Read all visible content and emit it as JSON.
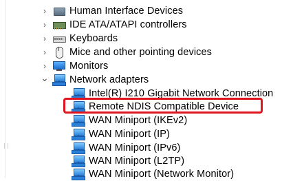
{
  "tree": {
    "categories": [
      {
        "label": "Human Interface Devices",
        "icon": "hid-device-icon",
        "expanded": false
      },
      {
        "label": "IDE ATA/ATAPI controllers",
        "icon": "ide-controller-icon",
        "expanded": false
      },
      {
        "label": "Keyboards",
        "icon": "keyboard-icon",
        "expanded": false
      },
      {
        "label": "Mice and other pointing devices",
        "icon": "mouse-icon",
        "expanded": false
      },
      {
        "label": "Monitors",
        "icon": "monitor-icon",
        "expanded": false
      },
      {
        "label": "Network adapters",
        "icon": "network-adapter-icon",
        "expanded": true
      }
    ],
    "network_adapters": [
      {
        "label": "Intel(R) I210 Gigabit Network Connection"
      },
      {
        "label": "Remote NDIS Compatible Device",
        "highlighted": true
      },
      {
        "label": "WAN Miniport (IKEv2)"
      },
      {
        "label": "WAN Miniport (IP)"
      },
      {
        "label": "WAN Miniport (IPv6)"
      },
      {
        "label": "WAN Miniport (L2TP)"
      },
      {
        "label": "WAN Miniport (Network Monitor)"
      }
    ]
  },
  "icons": {
    "collapsed_arrow": "›",
    "expanded_arrow": "⌄"
  },
  "colors": {
    "highlight_border": "#e0141e"
  }
}
